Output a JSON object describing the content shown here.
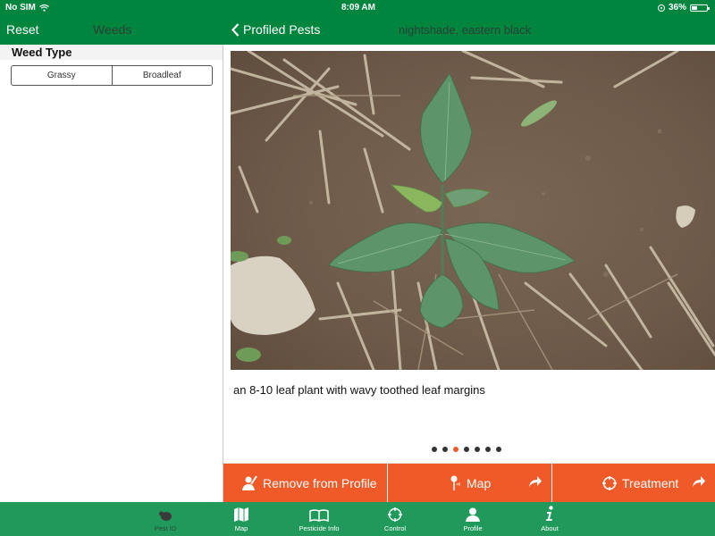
{
  "status_bar": {
    "carrier": "No SIM",
    "time": "8:09 AM",
    "battery": "36%"
  },
  "left_nav": {
    "reset_label": "Reset",
    "title": "Weeds"
  },
  "right_nav": {
    "back_label": "Profiled Pests",
    "title": "nightshade, eastern black"
  },
  "filter": {
    "section_title": "Weed Type",
    "options": [
      "Grassy",
      "Broadleaf"
    ]
  },
  "detail": {
    "image_description": "Young eastern black nightshade plant in soil with crop residue",
    "caption": "an 8-10 leaf plant with wavy toothed leaf margins",
    "page_count": 7,
    "current_page": 3
  },
  "actions": {
    "remove": "Remove from Profile",
    "map": "Map",
    "treatment": "Treatment"
  },
  "tabs": [
    {
      "label": "Pest ID",
      "icon": "bug-icon",
      "active": true
    },
    {
      "label": "Map",
      "icon": "map-icon",
      "active": false
    },
    {
      "label": "Pesticide Info",
      "icon": "book-icon",
      "active": false
    },
    {
      "label": "Control",
      "icon": "crosshair-icon",
      "active": false
    },
    {
      "label": "Profile",
      "icon": "person-icon",
      "active": false
    },
    {
      "label": "About",
      "icon": "info-icon",
      "active": false
    }
  ],
  "colors": {
    "header_green": "#00853f",
    "tabbar_green": "#20995a",
    "accent_orange": "#f05a28"
  }
}
